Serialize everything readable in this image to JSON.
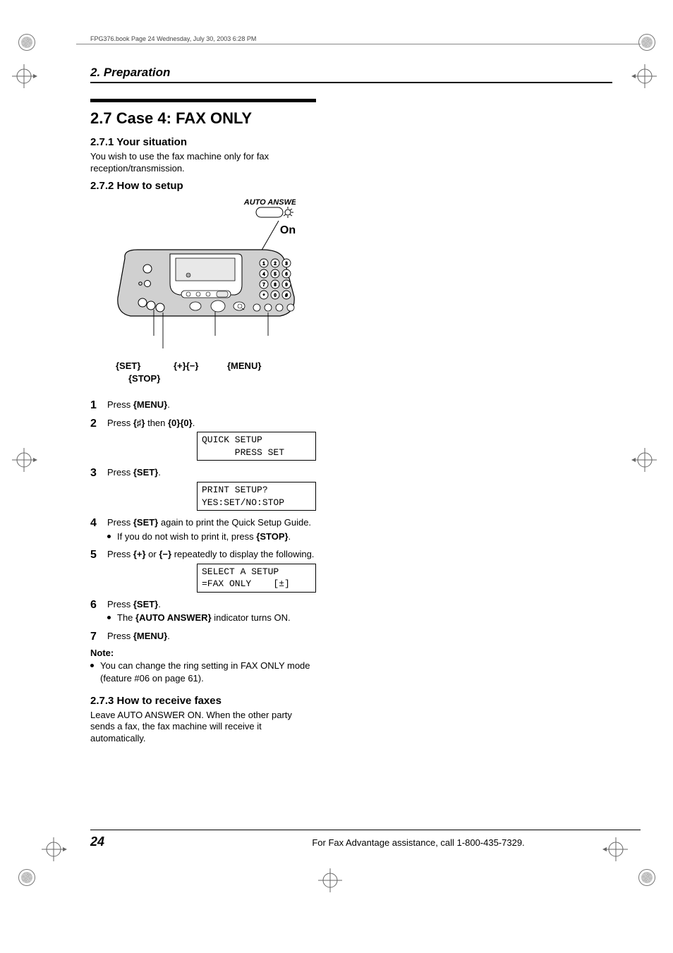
{
  "header_line": "FPG376.book  Page 24  Wednesday, July 30, 2003  6:28 PM",
  "chapter": "2. Preparation",
  "section_title": "2.7 Case 4: FAX ONLY",
  "s1": {
    "head": "2.7.1 Your situation",
    "text": "You wish to use the fax machine only for fax reception/transmission."
  },
  "s2": {
    "head": "2.7.2 How to setup"
  },
  "figure": {
    "auto_answer": "AUTO ANSWER",
    "on": "On",
    "set_label": "{SET}",
    "stop_label": "{STOP}",
    "plusminus_label": "{+}{−}",
    "menu_label": "{MENU}"
  },
  "steps": {
    "s1_a": "Press ",
    "s1_b": "{MENU}",
    "s1_c": ".",
    "s2_a": "Press ",
    "s2_b": "{♯}",
    "s2_c": " then ",
    "s2_d": "{0}{0}",
    "s2_e": ".",
    "lcd1": "QUICK SETUP\n      PRESS SET",
    "s3_a": "Press ",
    "s3_b": "{SET}",
    "s3_c": ".",
    "lcd2": "PRINT SETUP?\nYES:SET/NO:STOP",
    "s4_a": "Press ",
    "s4_b": "{SET}",
    "s4_c": " again to print the Quick Setup Guide.",
    "s4_sub_a": "If you do not wish to print it, press ",
    "s4_sub_b": "{STOP}",
    "s4_sub_c": ".",
    "s5_a": "Press ",
    "s5_b": "{+}",
    "s5_c": " or ",
    "s5_d": "{−}",
    "s5_e": " repeatedly to display the following.",
    "lcd3": "SELECT A SETUP\n=FAX ONLY    [±]",
    "s6_a": "Press ",
    "s6_b": "{SET}",
    "s6_c": ".",
    "s6_sub_a": "The ",
    "s6_sub_b": "{AUTO ANSWER}",
    "s6_sub_c": " indicator turns ON.",
    "s7_a": "Press ",
    "s7_b": "{MENU}",
    "s7_c": "."
  },
  "note": {
    "head": "Note:",
    "bullet": "You can change the ring setting in FAX ONLY mode (feature #06 on page 61)."
  },
  "s3": {
    "head": "2.7.3 How to receive faxes",
    "text": "Leave AUTO ANSWER ON. When the other party sends a fax, the fax machine will receive it automatically."
  },
  "footer": {
    "page": "24",
    "text": "For Fax Advantage assistance, call 1-800-435-7329."
  }
}
